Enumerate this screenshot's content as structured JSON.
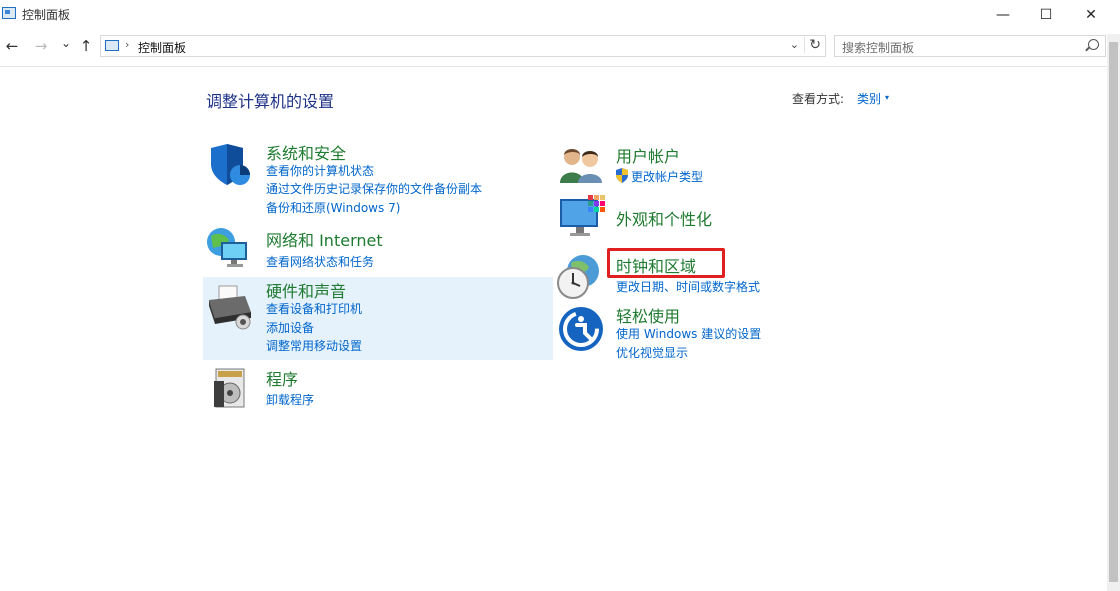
{
  "window": {
    "title": "控制面板",
    "minimize": "—",
    "maximize": "☐",
    "close": "✕"
  },
  "nav": {
    "back": "←",
    "forward": "→",
    "recent": "⌄",
    "up": "↑"
  },
  "address": {
    "separator": "›",
    "path": "控制面板",
    "dropdown": "⌄",
    "refresh": "↻"
  },
  "search": {
    "placeholder": "搜索控制面板"
  },
  "main": {
    "heading": "调整计算机的设置",
    "view_by_label": "查看方式:",
    "view_by_value": "类别",
    "view_by_caret": "▾"
  },
  "categories": {
    "security": {
      "title": "系统和安全",
      "links": [
        "查看你的计算机状态",
        "通过文件历史记录保存你的文件备份副本",
        "备份和还原(Windows 7)"
      ]
    },
    "network": {
      "title": "网络和 Internet",
      "links": [
        "查看网络状态和任务"
      ]
    },
    "hardware": {
      "title": "硬件和声音",
      "links": [
        "查看设备和打印机",
        "添加设备",
        "调整常用移动设置"
      ]
    },
    "programs": {
      "title": "程序",
      "links": [
        "卸载程序"
      ]
    },
    "accounts": {
      "title": "用户帐户",
      "links": [
        "更改帐户类型"
      ]
    },
    "appearance": {
      "title": "外观和个性化",
      "links": []
    },
    "clock": {
      "title": "时钟和区域",
      "links": [
        "更改日期、时间或数字格式"
      ]
    },
    "ease": {
      "title": "轻松使用",
      "links": [
        "使用 Windows 建议的设置",
        "优化视觉显示"
      ]
    }
  },
  "colors": {
    "category_title": "#1e7b30",
    "link": "#0066cc",
    "heading": "#1e3287",
    "highlight_box": "#e02020",
    "hover": "#e5f1fb"
  }
}
